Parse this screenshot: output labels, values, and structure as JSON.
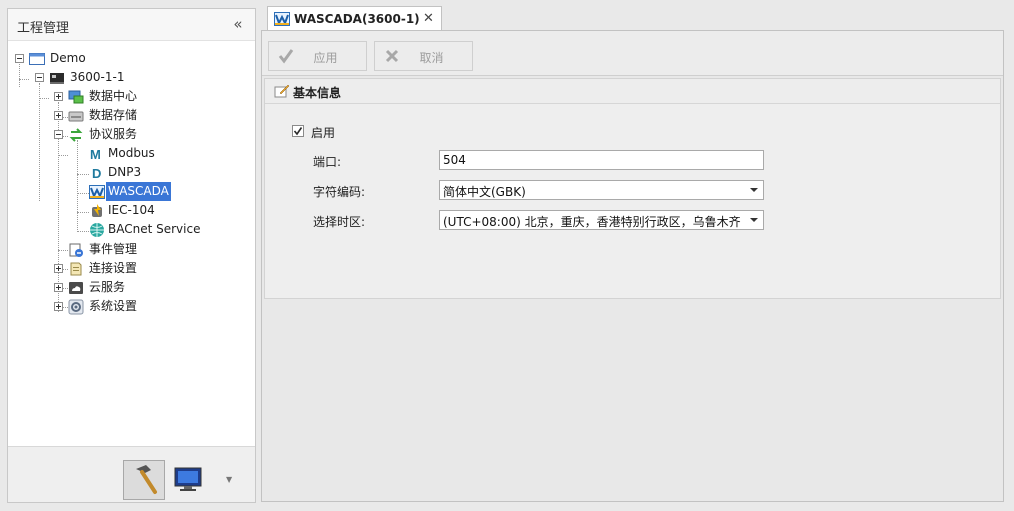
{
  "left_panel": {
    "title": "工程管理",
    "collapse_glyph": "«",
    "tree": [
      {
        "label": "Demo",
        "icon": "window-icon"
      },
      {
        "label": "3600-1-1",
        "icon": "device-icon"
      },
      {
        "label": "数据中心",
        "icon": "data-center-icon"
      },
      {
        "label": "数据存储",
        "icon": "storage-icon"
      },
      {
        "label": "协议服务",
        "icon": "protocol-icon"
      },
      {
        "label": "Modbus",
        "icon": "modbus-icon"
      },
      {
        "label": "DNP3",
        "icon": "dnp3-icon"
      },
      {
        "label": "WASCADA",
        "icon": "wascada-icon"
      },
      {
        "label": "IEC-104",
        "icon": "iec104-icon"
      },
      {
        "label": "BACnet Service",
        "icon": "bacnet-icon"
      },
      {
        "label": "事件管理",
        "icon": "event-icon"
      },
      {
        "label": "连接设置",
        "icon": "connection-icon"
      },
      {
        "label": "云服务",
        "icon": "cloud-icon"
      },
      {
        "label": "系统设置",
        "icon": "settings-icon"
      }
    ],
    "selected": "WASCADA",
    "footer": {
      "build_tool": "hammer-icon",
      "monitor_tool": "monitor-icon",
      "menu_glyph": "▼"
    }
  },
  "tab": {
    "title": "WASCADA(3600-1)",
    "close_glyph": "✕"
  },
  "toolbar": {
    "apply_label": "应用",
    "cancel_label": "取消"
  },
  "info": {
    "title": "基本信息",
    "enable_label": "启用",
    "enabled": true,
    "port_label": "端口:",
    "port_value": "504",
    "encoding_label": "字符编码:",
    "encoding_value": "简体中文(GBK)",
    "timezone_label": "选择时区:",
    "timezone_value": "(UTC+08:00) 北京，重庆，香港特别行政区，乌鲁木齐"
  },
  "colors": {
    "selection": "#3a76d6",
    "disabled_text": "#9d9d9d"
  }
}
